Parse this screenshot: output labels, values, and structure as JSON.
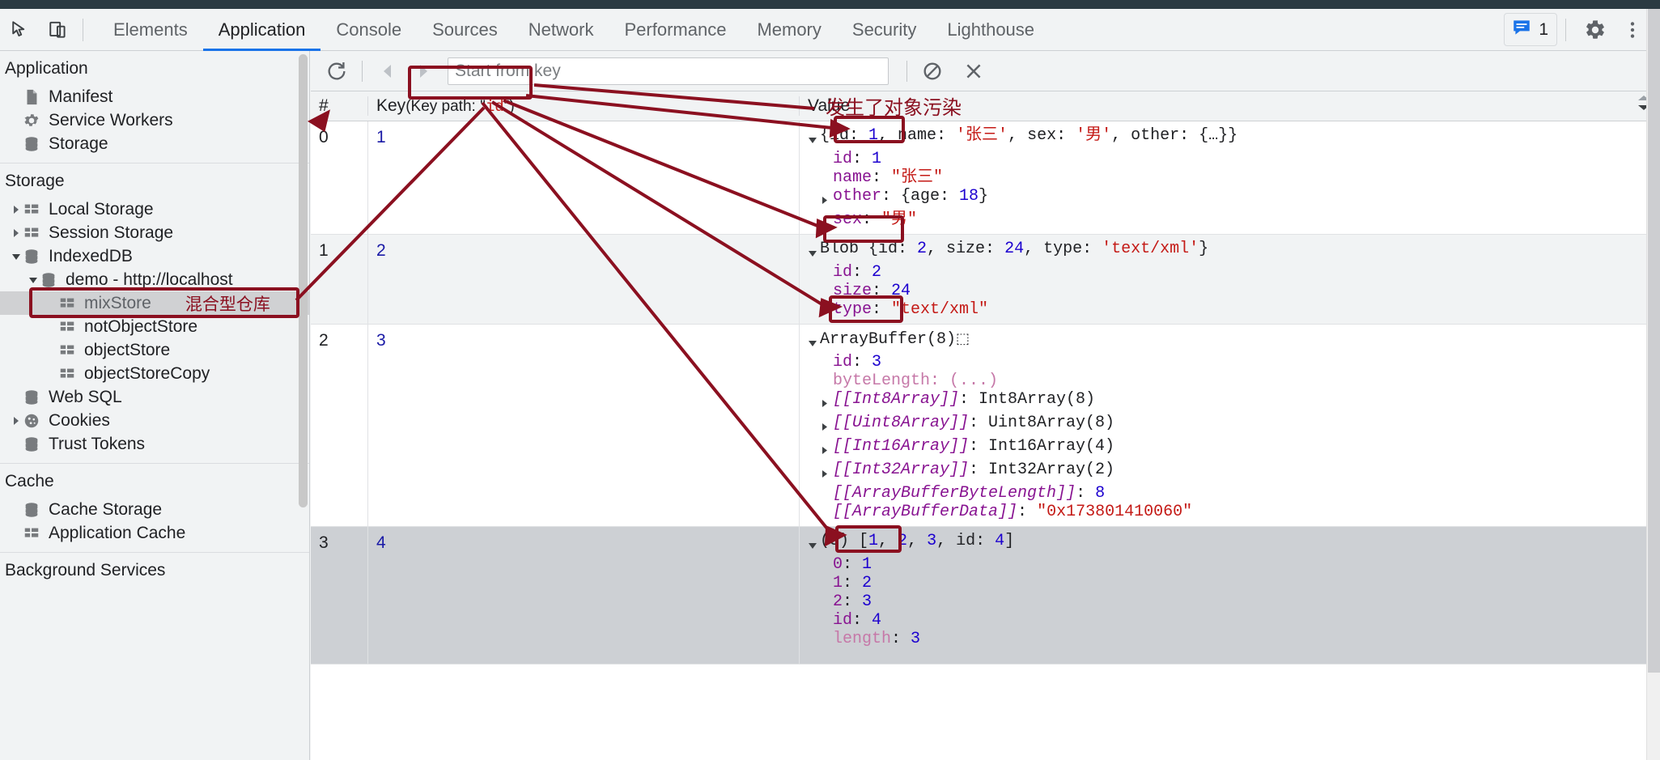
{
  "window": {
    "devtools_tabs": [
      {
        "label": "Elements",
        "active": false
      },
      {
        "label": "Application",
        "active": true
      },
      {
        "label": "Console",
        "active": false
      },
      {
        "label": "Sources",
        "active": false
      },
      {
        "label": "Network",
        "active": false
      },
      {
        "label": "Performance",
        "active": false
      },
      {
        "label": "Memory",
        "active": false
      },
      {
        "label": "Security",
        "active": false
      },
      {
        "label": "Lighthouse",
        "active": false
      }
    ],
    "message_count": "1",
    "icons": {
      "inspect": "inspect-element-icon",
      "device": "device-toolbar-icon",
      "messages": "messages-icon",
      "settings": "gear-icon",
      "more": "more-vertical-icon"
    }
  },
  "sidebar": {
    "sections": [
      {
        "title": "Application",
        "items": [
          {
            "label": "Manifest",
            "icon": "manifest-file-icon",
            "indent": 1,
            "arrow": "none"
          },
          {
            "label": "Service Workers",
            "icon": "gear-icon",
            "indent": 1,
            "arrow": "none"
          },
          {
            "label": "Storage",
            "icon": "database-icon",
            "indent": 1,
            "arrow": "none"
          }
        ]
      },
      {
        "title": "Storage",
        "items": [
          {
            "label": "Local Storage",
            "icon": "table-icon",
            "indent": 1,
            "arrow": "collapsed"
          },
          {
            "label": "Session Storage",
            "icon": "table-icon",
            "indent": 1,
            "arrow": "collapsed"
          },
          {
            "label": "IndexedDB",
            "icon": "database-icon",
            "indent": 1,
            "arrow": "expanded"
          },
          {
            "label": "demo - http://localhost",
            "icon": "database-icon",
            "indent": 2,
            "arrow": "expanded"
          },
          {
            "label": "mixStore",
            "icon": "table-icon",
            "indent": 3,
            "arrow": "none",
            "selected": true,
            "note": "混合型仓库"
          },
          {
            "label": "notObjectStore",
            "icon": "table-icon",
            "indent": 3,
            "arrow": "none"
          },
          {
            "label": "objectStore",
            "icon": "table-icon",
            "indent": 3,
            "arrow": "none"
          },
          {
            "label": "objectStoreCopy",
            "icon": "table-icon",
            "indent": 3,
            "arrow": "none"
          },
          {
            "label": "Web SQL",
            "icon": "database-icon",
            "indent": 1,
            "arrow": "none"
          },
          {
            "label": "Cookies",
            "icon": "cookie-icon",
            "indent": 1,
            "arrow": "collapsed"
          },
          {
            "label": "Trust Tokens",
            "icon": "database-icon",
            "indent": 1,
            "arrow": "none"
          }
        ]
      },
      {
        "title": "Cache",
        "items": [
          {
            "label": "Cache Storage",
            "icon": "database-icon",
            "indent": 1,
            "arrow": "none"
          },
          {
            "label": "Application Cache",
            "icon": "table-icon",
            "indent": 1,
            "arrow": "none"
          }
        ]
      },
      {
        "title": "Background Services",
        "items": []
      }
    ]
  },
  "toolbar": {
    "refresh_label": "refresh-icon",
    "prev_label": "previous-page-icon",
    "next_label": "next-page-icon",
    "search_placeholder": "Start from key",
    "search_value": "",
    "clear_label": "clear-object-store-icon",
    "delete_label": "delete-selected-icon"
  },
  "annotations": {
    "store_note": "混合型仓库",
    "pollution_note": "发生了对象污染"
  },
  "grid": {
    "headers": {
      "number": "#",
      "key": "Key",
      "key_path_prefix": "(Key path: \"",
      "key_path_value": "id",
      "key_path_suffix": "\")",
      "value": "Value"
    },
    "rows": [
      {
        "index": "0",
        "key": "1",
        "selected": false,
        "alt": false,
        "preview": [
          {
            "t": "{id: ",
            "c": "plain"
          },
          {
            "t": "1",
            "c": "num"
          },
          {
            "t": ", name: ",
            "c": "plain"
          },
          {
            "t": "'张三'",
            "c": "str"
          },
          {
            "t": ", sex: ",
            "c": "plain"
          },
          {
            "t": "'男'",
            "c": "str"
          },
          {
            "t": ", other: {…}}",
            "c": "plain"
          }
        ],
        "props": [
          {
            "tri": "none",
            "boxed": true,
            "parts": [
              {
                "t": "id",
                "c": "prop"
              },
              {
                "t": ": ",
                "c": "plain"
              },
              {
                "t": "1",
                "c": "num"
              }
            ]
          },
          {
            "tri": "none",
            "boxed": false,
            "parts": [
              {
                "t": "name",
                "c": "prop"
              },
              {
                "t": ": ",
                "c": "plain"
              },
              {
                "t": "\"张三\"",
                "c": "str"
              }
            ]
          },
          {
            "tri": "collapsed",
            "boxed": false,
            "parts": [
              {
                "t": "other",
                "c": "prop"
              },
              {
                "t": ": {age: ",
                "c": "plain"
              },
              {
                "t": "18",
                "c": "num"
              },
              {
                "t": "}",
                "c": "plain"
              }
            ]
          },
          {
            "tri": "none",
            "boxed": false,
            "parts": [
              {
                "t": "sex",
                "c": "prop"
              },
              {
                "t": ": ",
                "c": "plain"
              },
              {
                "t": "\"男\"",
                "c": "str"
              }
            ]
          }
        ]
      },
      {
        "index": "1",
        "key": "2",
        "selected": false,
        "alt": true,
        "preview": [
          {
            "t": "Blob {id: ",
            "c": "plain"
          },
          {
            "t": "2",
            "c": "num"
          },
          {
            "t": ", size: ",
            "c": "plain"
          },
          {
            "t": "24",
            "c": "num"
          },
          {
            "t": ", type: ",
            "c": "plain"
          },
          {
            "t": "'text/xml'",
            "c": "str"
          },
          {
            "t": "}",
            "c": "plain"
          }
        ],
        "props": [
          {
            "tri": "none",
            "boxed": true,
            "parts": [
              {
                "t": "id",
                "c": "prop"
              },
              {
                "t": ": ",
                "c": "plain"
              },
              {
                "t": "2",
                "c": "num"
              }
            ]
          },
          {
            "tri": "none",
            "boxed": false,
            "parts": [
              {
                "t": "size",
                "c": "prop"
              },
              {
                "t": ": ",
                "c": "plain"
              },
              {
                "t": "24",
                "c": "num"
              }
            ]
          },
          {
            "tri": "none",
            "boxed": false,
            "parts": [
              {
                "t": "type",
                "c": "prop"
              },
              {
                "t": ": ",
                "c": "plain"
              },
              {
                "t": "\"text/xml\"",
                "c": "str"
              }
            ]
          }
        ]
      },
      {
        "index": "2",
        "key": "3",
        "selected": false,
        "alt": false,
        "preview": [
          {
            "t": "ArrayBuffer(8)",
            "c": "plain"
          },
          {
            "t": "⬚",
            "c": "memicon"
          }
        ],
        "props": [
          {
            "tri": "none",
            "boxed": true,
            "parts": [
              {
                "t": "id",
                "c": "prop"
              },
              {
                "t": ": ",
                "c": "plain"
              },
              {
                "t": "3",
                "c": "num"
              }
            ]
          },
          {
            "tri": "none",
            "boxed": false,
            "parts": [
              {
                "t": "byteLength",
                "c": "propl"
              },
              {
                "t": ": (...)",
                "c": "propl"
              }
            ]
          },
          {
            "tri": "collapsed",
            "boxed": false,
            "parts": [
              {
                "t": "[[Int8Array]]",
                "c": "internal"
              },
              {
                "t": ": Int8Array(8)",
                "c": "plain"
              }
            ]
          },
          {
            "tri": "collapsed",
            "boxed": false,
            "parts": [
              {
                "t": "[[Uint8Array]]",
                "c": "internal"
              },
              {
                "t": ": Uint8Array(8)",
                "c": "plain"
              }
            ]
          },
          {
            "tri": "collapsed",
            "boxed": false,
            "parts": [
              {
                "t": "[[Int16Array]]",
                "c": "internal"
              },
              {
                "t": ": Int16Array(4)",
                "c": "plain"
              }
            ]
          },
          {
            "tri": "collapsed",
            "boxed": false,
            "parts": [
              {
                "t": "[[Int32Array]]",
                "c": "internal"
              },
              {
                "t": ": Int32Array(2)",
                "c": "plain"
              }
            ]
          },
          {
            "tri": "none",
            "boxed": false,
            "parts": [
              {
                "t": "[[ArrayBufferByteLength]]",
                "c": "internal"
              },
              {
                "t": ": ",
                "c": "plain"
              },
              {
                "t": "8",
                "c": "num"
              }
            ]
          },
          {
            "tri": "none",
            "boxed": false,
            "parts": [
              {
                "t": "[[ArrayBufferData]]",
                "c": "internal"
              },
              {
                "t": ": ",
                "c": "plain"
              },
              {
                "t": "\"0x173801410060\"",
                "c": "str"
              }
            ]
          }
        ]
      },
      {
        "index": "3",
        "key": "4",
        "selected": true,
        "alt": false,
        "preview": [
          {
            "t": "(3) [",
            "c": "plain"
          },
          {
            "t": "1",
            "c": "num"
          },
          {
            "t": ", ",
            "c": "plain"
          },
          {
            "t": "2",
            "c": "num"
          },
          {
            "t": ", ",
            "c": "plain"
          },
          {
            "t": "3",
            "c": "num"
          },
          {
            "t": ", id: ",
            "c": "plain"
          },
          {
            "t": "4",
            "c": "num"
          },
          {
            "t": "]",
            "c": "plain"
          }
        ],
        "props": [
          {
            "tri": "none",
            "boxed": false,
            "parts": [
              {
                "t": "0",
                "c": "prop"
              },
              {
                "t": ": ",
                "c": "plain"
              },
              {
                "t": "1",
                "c": "num"
              }
            ]
          },
          {
            "tri": "none",
            "boxed": false,
            "parts": [
              {
                "t": "1",
                "c": "prop"
              },
              {
                "t": ": ",
                "c": "plain"
              },
              {
                "t": "2",
                "c": "num"
              }
            ]
          },
          {
            "tri": "none",
            "boxed": false,
            "parts": [
              {
                "t": "2",
                "c": "prop"
              },
              {
                "t": ": ",
                "c": "plain"
              },
              {
                "t": "3",
                "c": "num"
              }
            ]
          },
          {
            "tri": "none",
            "boxed": true,
            "parts": [
              {
                "t": "id",
                "c": "prop"
              },
              {
                "t": ": ",
                "c": "plain"
              },
              {
                "t": "4",
                "c": "num"
              }
            ]
          },
          {
            "tri": "none",
            "boxed": false,
            "parts": [
              {
                "t": "length",
                "c": "propl"
              },
              {
                "t": ": ",
                "c": "plain"
              },
              {
                "t": "3",
                "c": "num"
              }
            ]
          }
        ]
      }
    ]
  },
  "colors": {
    "accent": "#1a73e8",
    "annotation": "#8b1020",
    "string": "#c41a16",
    "number": "#1c00cf",
    "property": "#881391",
    "selected_row": "#cdd0d4"
  }
}
